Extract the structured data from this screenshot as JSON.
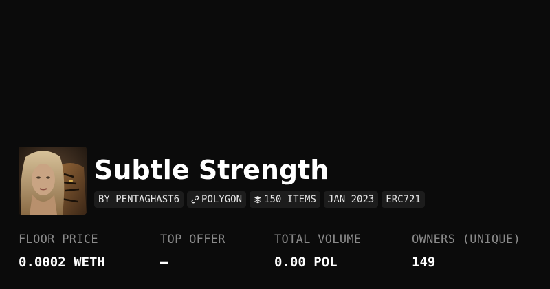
{
  "collection": {
    "title": "Subtle Strength",
    "avatar_alt": "collection-avatar"
  },
  "badges": {
    "creator": "BY PENTAGHAST6",
    "chain": "POLYGON",
    "chain_icon": "link-icon",
    "items": "150 ITEMS",
    "items_icon": "layers-icon",
    "date": "JAN 2023",
    "standard": "ERC721"
  },
  "stats": {
    "floor_label": "FLOOR PRICE",
    "floor_value": "0.0002 WETH",
    "offer_label": "TOP OFFER",
    "offer_value": "—",
    "volume_label": "TOTAL VOLUME",
    "volume_value": "0.00 POL",
    "owners_label": "OWNERS (UNIQUE)",
    "owners_value": "149"
  },
  "colors": {
    "background": "#0b0b0b",
    "badge_bg": "#1c1c1c",
    "label": "#8a8a8a",
    "text": "#ffffff"
  }
}
